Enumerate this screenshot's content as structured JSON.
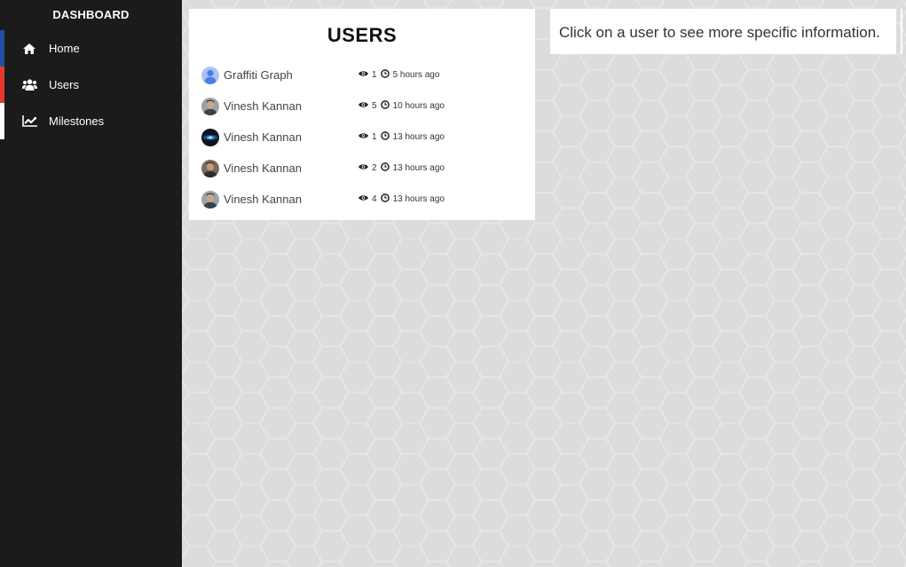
{
  "sidebar": {
    "brand": "DASHBOARD",
    "items": [
      {
        "label": "Home",
        "icon": "home-icon",
        "accent": "#1f4fa3"
      },
      {
        "label": "Users",
        "icon": "users-icon",
        "accent": "#e53a2b"
      },
      {
        "label": "Milestones",
        "icon": "line-chart-icon",
        "accent": "#ffffff"
      }
    ]
  },
  "users_panel": {
    "title": "USERS",
    "users": [
      {
        "name": "Graffiti Graph",
        "views": "1",
        "time": "5 hours ago",
        "avatar": "default-avatar"
      },
      {
        "name": "Vinesh Kannan",
        "views": "5",
        "time": "10 hours ago",
        "avatar": "photo-avatar"
      },
      {
        "name": "Vinesh Kannan",
        "views": "1",
        "time": "13 hours ago",
        "avatar": "dark-avatar"
      },
      {
        "name": "Vinesh Kannan",
        "views": "2",
        "time": "13 hours ago",
        "avatar": "photo-avatar"
      },
      {
        "name": "Vinesh Kannan",
        "views": "4",
        "time": "13 hours ago",
        "avatar": "photo-avatar"
      }
    ]
  },
  "info": {
    "text": "Click on a user to see more specific information."
  },
  "colors": {
    "sidebar_bg": "#1b1b1b",
    "page_bg": "#dcdcdc",
    "card_bg": "#ffffff"
  }
}
